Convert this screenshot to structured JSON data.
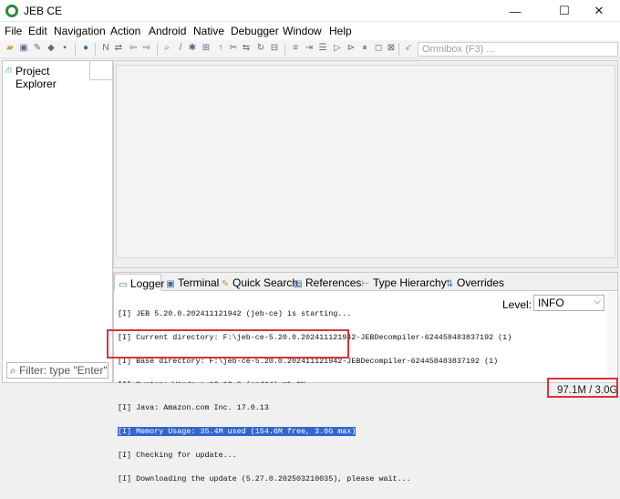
{
  "window": {
    "title": "JEB CE",
    "minimize_glyph": "—",
    "maximize_glyph": "☐",
    "close_glyph": "✕"
  },
  "menubar": {
    "items": [
      "File",
      "Edit",
      "Navigation",
      "Action",
      "Android",
      "Native",
      "Debugger",
      "Window",
      "Help"
    ]
  },
  "toolbar": {
    "icons": [
      "open-folder-icon",
      "save-icon",
      "wrench-icon",
      "decompile-icon",
      "chip-icon",
      "globe-icon",
      "rename-icon",
      "comment-icon",
      "navigate-back-icon",
      "navigate-forward-icon",
      "search-icon",
      "find-icon",
      "graph-icon",
      "hierarchy-icon",
      "type-icon",
      "cut-icon",
      "xref-icon",
      "refresh-icon",
      "split-icon",
      "tag-icon",
      "export-icon",
      "rocket-icon"
    ],
    "omnibox_placeholder": "Omnibox (F3) ..."
  },
  "left_panel": {
    "tab_label": "Project Explorer",
    "filter_placeholder": "Filter: type \"Enter\""
  },
  "bottom_panel": {
    "tabs": [
      {
        "label": "Logger",
        "icon": "monitor-icon"
      },
      {
        "label": "Terminal",
        "icon": "terminal-icon"
      },
      {
        "label": "Quick Search",
        "icon": "wand-icon"
      },
      {
        "label": "References",
        "icon": "references-icon"
      },
      {
        "label": "Type Hierarchy",
        "icon": "hierarchy-icon"
      },
      {
        "label": "Overrides",
        "icon": "overrides-icon"
      }
    ],
    "log_lines": [
      "[I] JEB 5.20.0.202411121942 (jeb-ce) is starting...",
      "[I] Current directory: F:\\jeb-ce-5.20.0.202411121942-JEBDecompiler-624458483837192 (1)",
      "[I] Base directory: F:\\jeb-ce-5.20.0.202411121942-JEBDecompiler-624458483837192 (1)",
      "[I] System: Windows 10 10.0 (amd64) zh_CN",
      "[I] Java: Amazon.com Inc. 17.0.13",
      "[I] Memory Usage: 35.4M used (154.6M free, 3.0G max)",
      "[I] Checking for update...",
      "[I] Downloading the update (5.27.0.202503210035), please wait..."
    ],
    "selected_line_index": 5,
    "level_label": "Level:",
    "level_value": "INFO"
  },
  "statusbar": {
    "memory": "97.1M / 3.0G"
  },
  "colors": {
    "annotation": "#e0303a",
    "selection": "#3366cc"
  }
}
